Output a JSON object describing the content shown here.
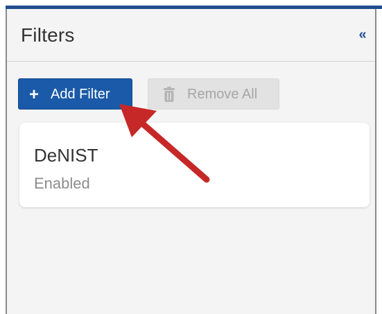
{
  "panel": {
    "title": "Filters",
    "collapse_glyph": "«",
    "collapse_icon": "double-chevron-left-icon"
  },
  "toolbar": {
    "add_label": "Add Filter",
    "add_icon": "plus-icon",
    "remove_label": "Remove All",
    "remove_icon": "trash-icon",
    "remove_disabled": true
  },
  "filters": [
    {
      "name": "DeNIST",
      "status": "Enabled"
    }
  ],
  "annotation": {
    "icon": "red-arrow-icon",
    "color": "#c62828"
  },
  "colors": {
    "accent": "#1a5aa8",
    "header_rule": "#1f4f8f",
    "disabled_bg": "#e2e2e2",
    "disabled_text": "#a6a6a6"
  }
}
